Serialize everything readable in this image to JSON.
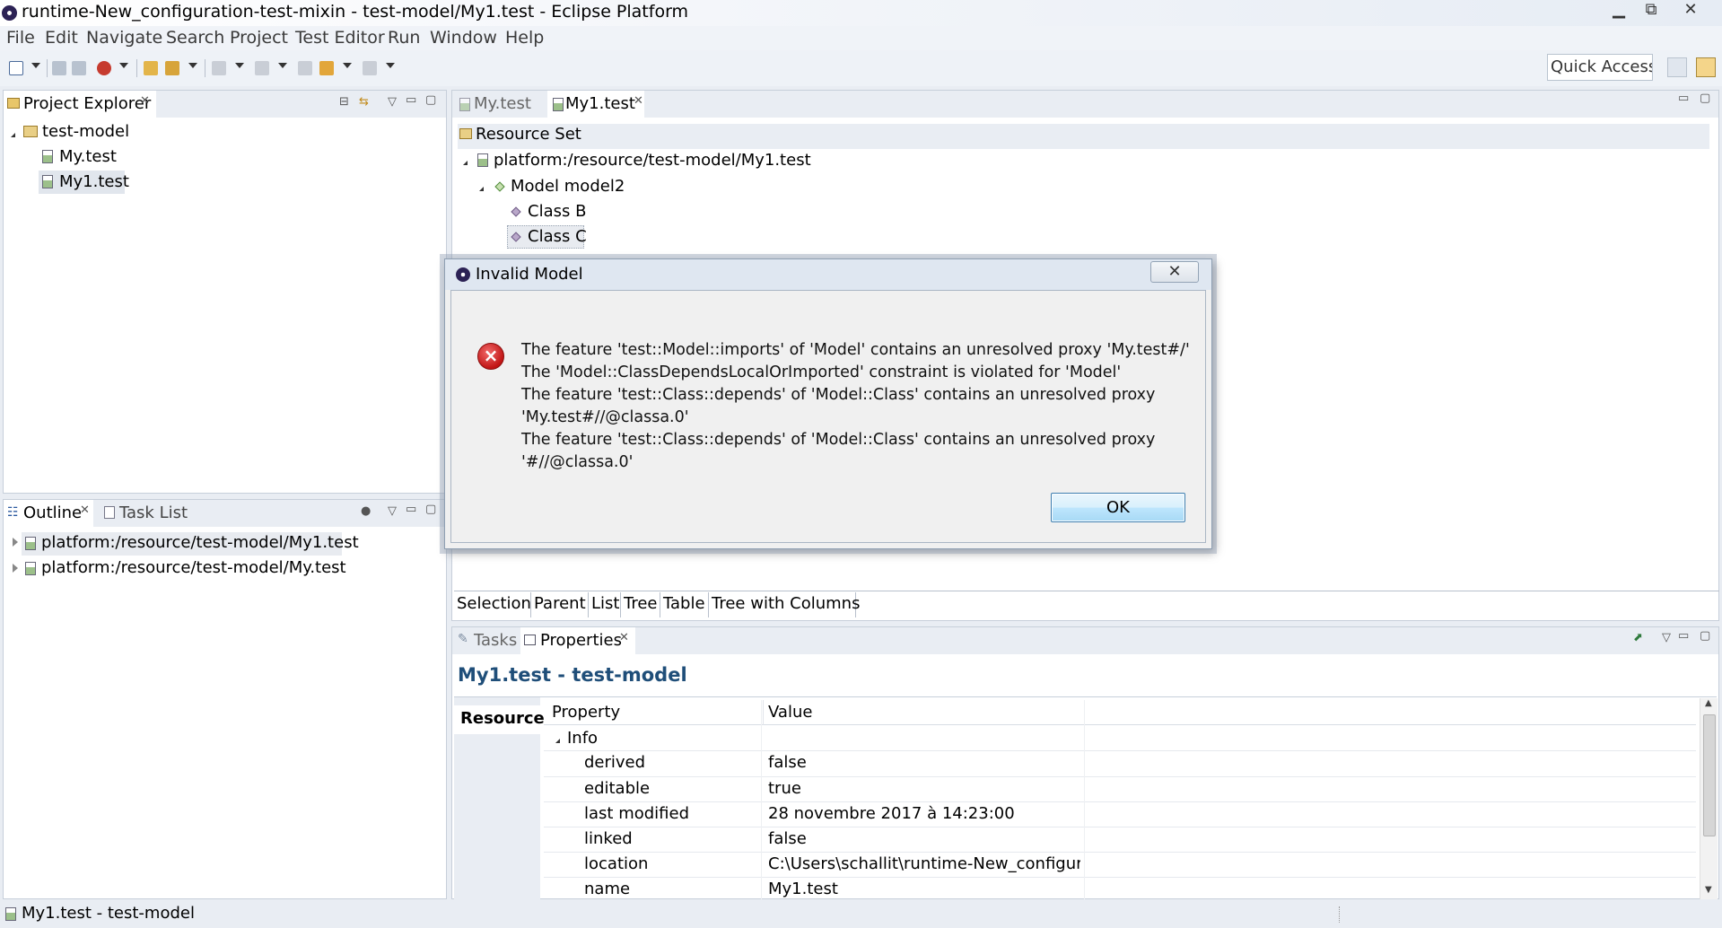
{
  "window": {
    "title": "runtime-New_configuration-test-mixin - test-model/My1.test - Eclipse Platform",
    "minimize": "▁",
    "maximize": "⧉",
    "close": "✕"
  },
  "menu": [
    "File",
    "Edit",
    "Navigate",
    "Search",
    "Project",
    "Test Editor",
    "Run",
    "Window",
    "Help"
  ],
  "toolbar": {
    "quick_access": "Quick Access"
  },
  "project_explorer": {
    "tab_label": "Project Explorer",
    "tree": {
      "project": "test-model",
      "files": [
        "My.test",
        "My1.test"
      ],
      "selected": "My1.test"
    }
  },
  "outline": {
    "tabs": [
      "Outline",
      "Task List"
    ],
    "items": [
      "platform:/resource/test-model/My1.test",
      "platform:/resource/test-model/My.test"
    ]
  },
  "editor": {
    "tabs": [
      "My.test",
      "My1.test"
    ],
    "active_tab": "My1.test",
    "root": "Resource Set",
    "resource": "platform:/resource/test-model/My1.test",
    "model": "Model model2",
    "classes": [
      "Class B",
      "Class C"
    ],
    "bottom_tabs": [
      "Selection",
      "Parent",
      "List",
      "Tree",
      "Table",
      "Tree with Columns"
    ]
  },
  "dialog": {
    "title": "Invalid Model",
    "close": "✕",
    "icon": "error-icon",
    "lines": [
      "The feature 'test::Model::imports' of 'Model' contains an unresolved proxy 'My.test#/'",
      "The 'Model::ClassDependsLocalOrImported' constraint is violated for 'Model'",
      "The feature 'test::Class::depends' of 'Model::Class' contains an unresolved proxy",
      "'My.test#//@classa.0'",
      "The feature 'test::Class::depends' of 'Model::Class' contains an unresolved proxy",
      "'#//@classa.0'"
    ],
    "ok_label": "OK"
  },
  "properties": {
    "tabs": [
      "Tasks",
      "Properties"
    ],
    "header": "My1.test - test-model",
    "side_tab": "Resource",
    "columns": [
      "Property",
      "Value"
    ],
    "group": "Info",
    "rows": [
      {
        "property": "derived",
        "value": "false"
      },
      {
        "property": "editable",
        "value": "true"
      },
      {
        "property": "last modified",
        "value": "28 novembre 2017 à 14:23:00"
      },
      {
        "property": "linked",
        "value": "false"
      },
      {
        "property": "location",
        "value": "C:\\Users\\schallit\\runtime-New_configur..."
      },
      {
        "property": "name",
        "value": "My1.test"
      }
    ]
  },
  "status_bar": {
    "text": "My1.test - test-model"
  },
  "colors": {
    "accent": "#1f4e79",
    "selection": "#e1e6ed",
    "error": "#c11515"
  }
}
